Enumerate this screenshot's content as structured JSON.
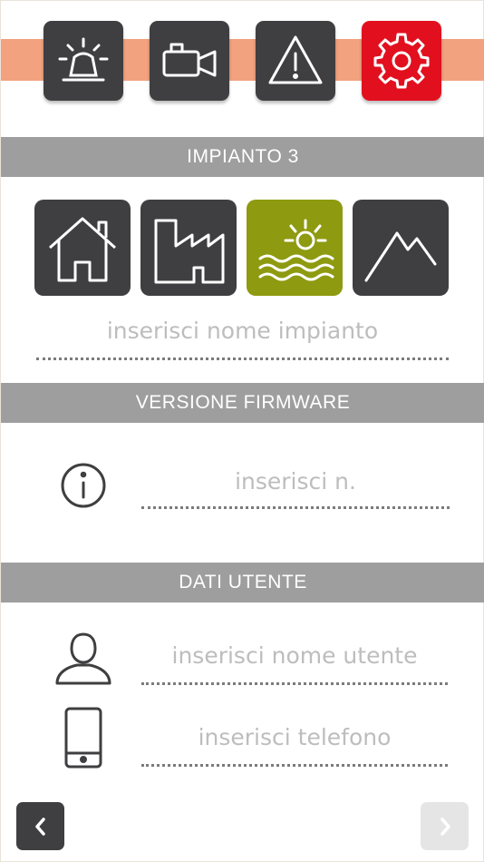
{
  "toolbar": {
    "tabs": [
      {
        "name": "alarm-siren-icon",
        "active": false
      },
      {
        "name": "video-camera-icon",
        "active": false
      },
      {
        "name": "warning-icon",
        "active": false
      },
      {
        "name": "settings-gear-icon",
        "active": true
      }
    ],
    "strip_color": "#f2a27f",
    "active_color": "#e2101f"
  },
  "sections": {
    "impianto_title": "IMPIANTO 3",
    "firmware_title": "VERSIONE FIRMWARE",
    "user_title": "DATI UTENTE"
  },
  "impianto": {
    "types": [
      {
        "name": "house-icon",
        "selected": false
      },
      {
        "name": "factory-icon",
        "selected": false
      },
      {
        "name": "sea-sun-icon",
        "selected": true
      },
      {
        "name": "mountain-icon",
        "selected": false
      }
    ],
    "selected_color": "#8e9a10",
    "name_placeholder": "inserisci nome impianto",
    "name_value": ""
  },
  "firmware": {
    "placeholder": "inserisci n.",
    "value": ""
  },
  "user": {
    "name_placeholder": "inserisci nome utente",
    "name_value": "",
    "phone_placeholder": "inserisci telefono",
    "phone_value": ""
  },
  "nav": {
    "back_glyph": "‹",
    "next_glyph": "›"
  }
}
